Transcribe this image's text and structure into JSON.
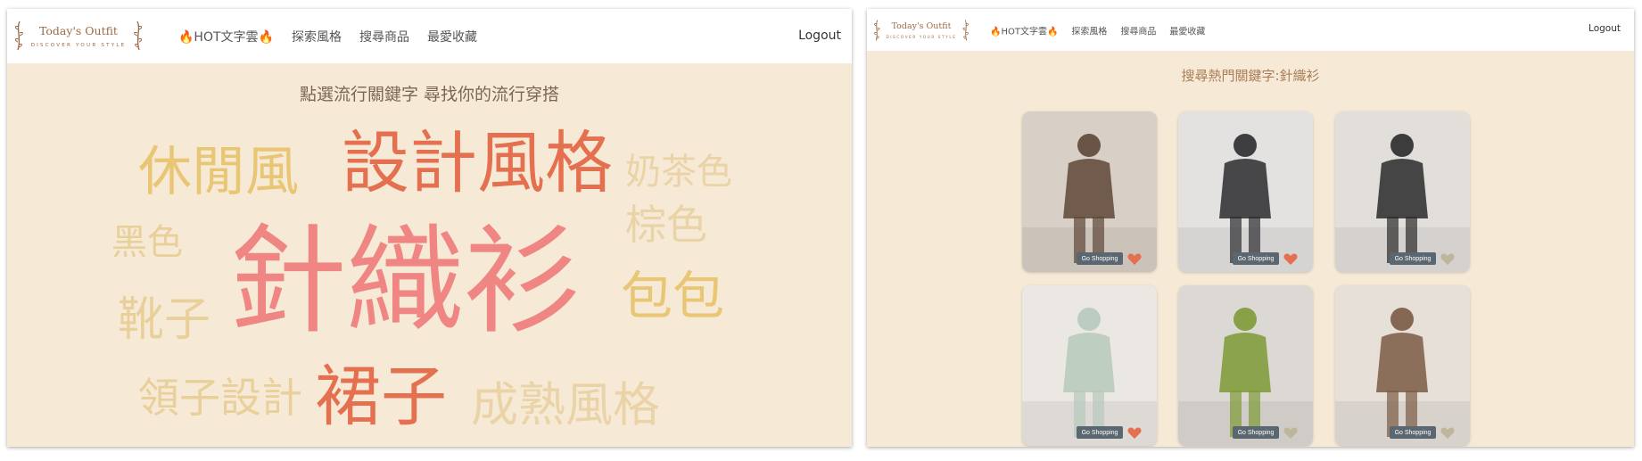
{
  "brand": {
    "title": "Today's Outfit",
    "subtitle": "DISCOVER YOUR STYLE"
  },
  "nav": {
    "items": [
      "🔥HOT文字雲🔥",
      "探索風格",
      "搜尋商品",
      "最愛收藏"
    ],
    "logout": "Logout"
  },
  "word_cloud_page": {
    "title": "點選流行關鍵字 尋找你的流行穿搭",
    "words": [
      {
        "text": "針織衫",
        "color": "#ef8683"
      },
      {
        "text": "設計風格",
        "color": "#e4704f"
      },
      {
        "text": "裙子",
        "color": "#e4704f"
      },
      {
        "text": "休閒風",
        "color": "#e9c674"
      },
      {
        "text": "包包",
        "color": "#e9c674"
      },
      {
        "text": "奶茶色",
        "color": "#ead3a6"
      },
      {
        "text": "棕色",
        "color": "#ead3a6"
      },
      {
        "text": "黑色",
        "color": "#e9d09b"
      },
      {
        "text": "靴子",
        "color": "#e9d09b"
      },
      {
        "text": "領子設計",
        "color": "#e9d09b"
      },
      {
        "text": "成熟風格",
        "color": "#ead3a6"
      }
    ]
  },
  "search_page": {
    "title": "搜尋熱門關鍵字:針織衫",
    "cards": [
      {
        "button": "Go Shopping",
        "favorited": true,
        "colors": {
          "bg": "#d8cfc6",
          "figure": "#5e4636"
        }
      },
      {
        "button": "Go Shopping",
        "favorited": true,
        "colors": {
          "bg": "#e4e2e0",
          "figure": "#2b2b2f"
        }
      },
      {
        "button": "Go Shopping",
        "favorited": false,
        "colors": {
          "bg": "#e2dfdb",
          "figure": "#2a2a2a"
        }
      },
      {
        "button": "Go Shopping",
        "favorited": true,
        "colors": {
          "bg": "#ebe7e3",
          "figure": "#b6c9bb"
        }
      },
      {
        "button": "Go Shopping",
        "favorited": false,
        "colors": {
          "bg": "#dcd8d3",
          "figure": "#7e9a36"
        }
      },
      {
        "button": "Go Shopping",
        "favorited": false,
        "colors": {
          "bg": "#e6e0d9",
          "figure": "#7a5a44"
        }
      }
    ],
    "heart_colors": {
      "favorited": "#e4704f",
      "not_favorited": "#bfb59a"
    }
  }
}
